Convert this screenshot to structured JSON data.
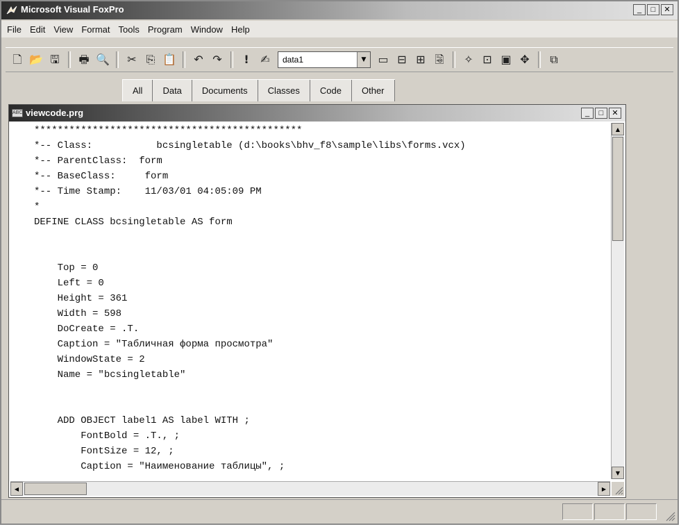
{
  "app": {
    "title": "Microsoft Visual FoxPro",
    "window_controls": [
      "minimize-icon",
      "restore-icon",
      "close-icon"
    ]
  },
  "menu": [
    "File",
    "Edit",
    "View",
    "Format",
    "Tools",
    "Program",
    "Window",
    "Help"
  ],
  "toolbar": {
    "database_dropdown": "data1",
    "buttons": [
      "new-file-icon",
      "open-folder-icon",
      "save-icon",
      "print-icon",
      "print-preview-icon",
      "cut-icon",
      "copy-icon",
      "paste-icon",
      "undo-icon",
      "redo-icon",
      "run-icon",
      "modify-form-icon",
      "command-window-icon",
      "view-window-icon",
      "properties-icon",
      "code-icon",
      "wizard-icon",
      "form-designer-icon",
      "report-designer-icon",
      "builder-icon",
      "toolbar-toggle-icon"
    ]
  },
  "tabs": [
    "All",
    "Data",
    "Documents",
    "Classes",
    "Code",
    "Other"
  ],
  "code_window": {
    "title": "viewcode.prg",
    "lines": [
      "**********************************************",
      "*-- Class:           bcsingletable (d:\\books\\bhv_f8\\sample\\libs\\forms.vcx)",
      "*-- ParentClass:  form",
      "*-- BaseClass:     form",
      "*-- Time Stamp:    11/03/01 04:05:09 PM",
      "*",
      "DEFINE CLASS bcsingletable AS form",
      "",
      "",
      "    Top = 0",
      "    Left = 0",
      "    Height = 361",
      "    Width = 598",
      "    DoCreate = .T.",
      "    Caption = \"Табличная форма просмотра\"",
      "    WindowState = 2",
      "    Name = \"bcsingletable\"",
      "",
      "",
      "    ADD OBJECT label1 AS label WITH ;",
      "        FontBold = .T., ;",
      "        FontSize = 12, ;",
      "        Caption = \"Наименование таблицы\", ;"
    ]
  }
}
